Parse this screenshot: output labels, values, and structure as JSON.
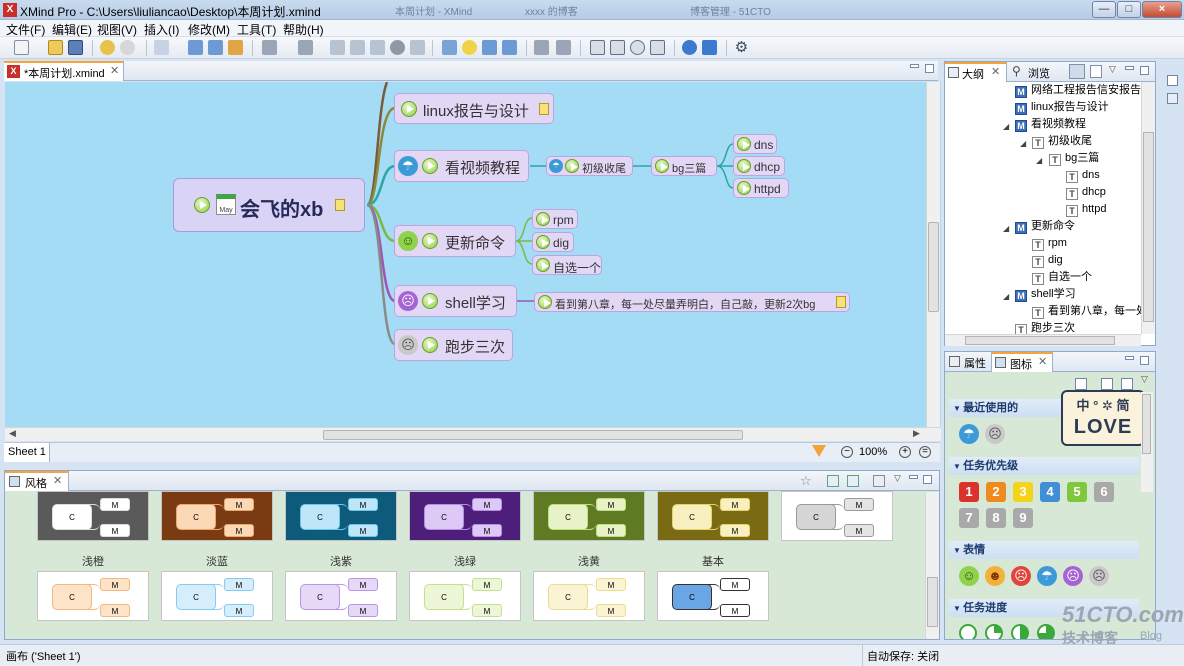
{
  "window": {
    "title": "XMind Pro - C:\\Users\\liuliancao\\Desktop\\本周计划.xmind",
    "background_tabs": [
      "本周计划 - XMind",
      "xxxx 的博客",
      "博客管理 - 51CTO"
    ],
    "min": "—",
    "max": "□",
    "close": "×"
  },
  "menu": [
    "文件(F)",
    "编辑(E)",
    "视图(V)",
    "插入(I)",
    "修改(M)",
    "工具(T)",
    "帮助(H)"
  ],
  "editor": {
    "tab": "*本周计划.xmind",
    "sheet": "Sheet 1",
    "zoom": "100%"
  },
  "mindmap": {
    "central": {
      "label": "会飞的xb",
      "date_icon": "May"
    },
    "branches": [
      {
        "label": "linux报告与设计"
      },
      {
        "label": "看视频教程",
        "children": [
          {
            "label": "初级收尾",
            "children": [
              {
                "label": "bg三篇",
                "children": [
                  {
                    "label": "dns"
                  },
                  {
                    "label": "dhcp"
                  },
                  {
                    "label": "httpd"
                  }
                ]
              }
            ]
          }
        ]
      },
      {
        "label": "更新命令",
        "children": [
          {
            "label": "rpm"
          },
          {
            "label": "dig"
          },
          {
            "label": "自选一个"
          }
        ]
      },
      {
        "label": "shell学习",
        "children": [
          {
            "label": "看到第八章，每一处尽量弄明白，自己敲，更新2次bg"
          }
        ]
      },
      {
        "label": "跑步三次"
      }
    ]
  },
  "outline": {
    "tabs": [
      "大纲",
      "浏览"
    ],
    "rows": [
      {
        "icon": "M",
        "label": "网络工程报告信安报告"
      },
      {
        "icon": "M",
        "label": "linux报告与设计"
      },
      {
        "icon": "M",
        "label": "看视频教程"
      },
      {
        "icon": "T",
        "label": "初级收尾"
      },
      {
        "icon": "T",
        "label": "bg三篇"
      },
      {
        "icon": "T",
        "label": "dns"
      },
      {
        "icon": "T",
        "label": "dhcp"
      },
      {
        "icon": "T",
        "label": "httpd"
      },
      {
        "icon": "M",
        "label": "更新命令"
      },
      {
        "icon": "T",
        "label": "rpm"
      },
      {
        "icon": "T",
        "label": "dig"
      },
      {
        "icon": "T",
        "label": "自选一个"
      },
      {
        "icon": "M",
        "label": "shell学习"
      },
      {
        "icon": "T",
        "label": "看到第八章，每一处"
      },
      {
        "icon": "T",
        "label": "跑步三次"
      }
    ]
  },
  "icons_panel": {
    "tabs": [
      "属性",
      "图标"
    ],
    "sections": [
      "最近使用的",
      "任务优先级",
      "表情",
      "任务进度"
    ],
    "priorities": [
      "1",
      "2",
      "3",
      "4",
      "5",
      "6",
      "7",
      "8",
      "9"
    ],
    "priority_colors": [
      "#d9332b",
      "#ef8a1d",
      "#f5d21c",
      "#3f8fd6",
      "#7fc73c",
      "#a9a9a9",
      "#a9a9a9",
      "#a9a9a9",
      "#a9a9a9"
    ]
  },
  "styles": {
    "tab": "风格",
    "row1": [
      {
        "bg": "#5a5a5a",
        "c": "#ffffff",
        "m": "#ffffff",
        "line": "#dddddd"
      },
      {
        "bg": "#7a3b12",
        "c": "#fbd9b6",
        "m": "#fbd9b6",
        "line": "#f0a56a"
      },
      {
        "bg": "#0e5a7a",
        "c": "#bfe6f8",
        "m": "#bfe6f8",
        "line": "#6cc5ea"
      },
      {
        "bg": "#4d1f7a",
        "c": "#ddc8f6",
        "m": "#ddc8f6",
        "line": "#b58ce6"
      },
      {
        "bg": "#5e7a22",
        "c": "#e7f3c6",
        "m": "#e7f3c6",
        "line": "#bedf7f"
      },
      {
        "bg": "#7a6a14",
        "c": "#f9f0c1",
        "m": "#f9f0c1",
        "line": "#e6d36a"
      },
      {
        "bg": "#ffffff",
        "c": "#d6d6d6",
        "m": "#e4e4e4",
        "line": "#9a9a9a"
      }
    ],
    "row2": [
      {
        "name": "浅橙",
        "bg": "#ffffff",
        "c": "#fde3c8",
        "m": "#fde3c8",
        "line": "#f3b77f"
      },
      {
        "name": "淡蓝",
        "bg": "#ffffff",
        "c": "#d6eefb",
        "m": "#d6eefb",
        "line": "#86ccef"
      },
      {
        "name": "浅紫",
        "bg": "#ffffff",
        "c": "#e6d8f7",
        "m": "#e6d8f7",
        "line": "#b996e4"
      },
      {
        "name": "浅绿",
        "bg": "#ffffff",
        "c": "#eef6d8",
        "m": "#eef6d8",
        "line": "#c4e18d"
      },
      {
        "name": "浅黄",
        "bg": "#ffffff",
        "c": "#fbf4d4",
        "m": "#fbf4d4",
        "line": "#eedb8c"
      },
      {
        "name": "基本",
        "bg": "#ffffff",
        "c": "#6aa6e6",
        "m": "#ffffff",
        "line": "#333333"
      }
    ]
  },
  "status": {
    "left": "画布 ('Sheet 1')",
    "right": "自动保存: 关闭"
  },
  "watermark": {
    "site": "51CTO.com",
    "sub": "技术博客",
    "blog": "Blog",
    "badge_top": "中 ° ✲ 简",
    "badge_word": "LOVE"
  }
}
